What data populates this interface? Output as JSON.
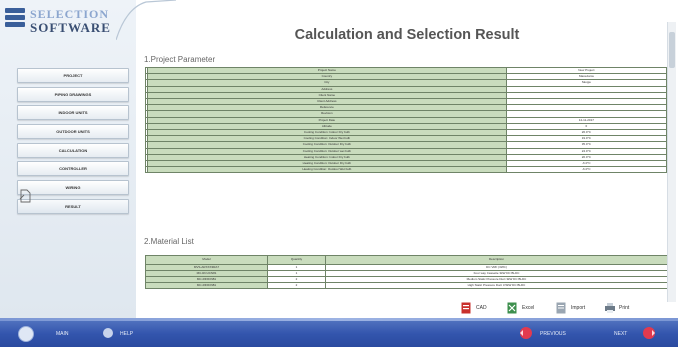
{
  "app": {
    "logo_line1": "SELECTION",
    "logo_line2": "SOFTWARE"
  },
  "sidebar": {
    "items": [
      {
        "label": "PROJECT"
      },
      {
        "label": "PIPING DRAWINGS"
      },
      {
        "label": "INDOOR UNITS"
      },
      {
        "label": "OUTDOOR UNITS"
      },
      {
        "label": "CALCULATION"
      },
      {
        "label": "CONTROLLER"
      },
      {
        "label": "WIRING"
      },
      {
        "label": "RESULT"
      }
    ]
  },
  "main": {
    "title": "Calculation and Selection Result",
    "section1": "1.Project Parameter",
    "section2": "2.Material List",
    "params": [
      {
        "label": "Project Name",
        "value": "New Project"
      },
      {
        "label": "Country",
        "value": "Macedonia"
      },
      {
        "label": "City",
        "value": "Skopje"
      },
      {
        "label": "Address",
        "value": ""
      },
      {
        "label": "Client Name",
        "value": ""
      },
      {
        "label": "Client Address",
        "value": ""
      },
      {
        "label": "Reference",
        "value": ""
      },
      {
        "label": "Revision",
        "value": ""
      },
      {
        "label": "Project Date",
        "value": "12-11-2017"
      },
      {
        "label": "Altitude",
        "value": "0"
      },
      {
        "label": "Cooling Condition: Indoor Dry bulb",
        "value": "26.0°C"
      },
      {
        "label": "Cooling Condition: Indoor Wet bulb",
        "value": "19.0°C"
      },
      {
        "label": "Cooling Condition: Outdoor Dry bulb",
        "value": "35.0°C"
      },
      {
        "label": "Cooling Condition: Outdoor wet bulb",
        "value": "24.0°C"
      },
      {
        "label": "Heating Condition: Indoor Dry bulb",
        "value": "20.0°C"
      },
      {
        "label": "Heating Condition: Outdoor Dry bulb",
        "value": "-6.0°C"
      },
      {
        "label": "Heating Condition: Outdoor Wet bulb",
        "value": "-6.0°C"
      }
    ],
    "material_headers": [
      "Model",
      "Quantity",
      "Description"
    ],
    "materials": [
      {
        "model": "MVS-ARXXX3RA7",
        "qty": "1",
        "desc": "DC VRF (3WC)"
      },
      {
        "model": "MC-RCUCN81",
        "qty": "1",
        "desc": "Four way Cassette 3kW DC BLDC"
      },
      {
        "model": "MC-RFFDN81",
        "qty": "2",
        "desc": "Medium Static Pressure Duct 3kW DC BLDC"
      },
      {
        "model": "MC-RFFDN81",
        "qty": "2",
        "desc": "High Static Pressure Duct 3.5kW DC BLDC"
      }
    ]
  },
  "export": {
    "cad": "CAD",
    "excel": "Excel",
    "import": "Import",
    "print": "Print"
  },
  "bottombar": {
    "main": "MAIN",
    "help": "HELP",
    "previous": "PREVIOUS",
    "next": "NEXT"
  },
  "colors": {
    "accent": "#3355ad",
    "table_green": "#c9dcbd",
    "nav_red": "#e23a4f"
  }
}
